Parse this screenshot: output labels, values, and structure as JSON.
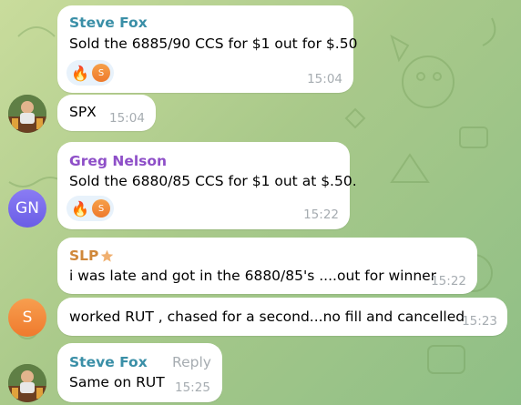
{
  "messages": [
    {
      "sender": "Steve Fox",
      "name_color": "#3a8fa7",
      "text": "Sold the 6885/90 CCS for $1 out for $.50",
      "time": "15:04",
      "reaction": {
        "emoji": "🔥",
        "avatar_letter": "S"
      }
    },
    {
      "text": "SPX",
      "time": "15:04"
    },
    {
      "sender": "Greg Nelson",
      "name_color": "#8e4fc8",
      "text": "Sold the 6880/85 CCS for $1 out at $.50.",
      "time": "15:22",
      "reaction": {
        "emoji": "🔥",
        "avatar_letter": "S"
      },
      "avatar_initials": "GN"
    },
    {
      "sender": "SLP",
      "name_color": "#d0883a",
      "text": "i was late and got in the 6880/85's ....out for winner",
      "time": "15:22"
    },
    {
      "text": "worked RUT , chased for a second...no fill and cancelled",
      "time": "15:23",
      "avatar_initials": "S"
    },
    {
      "sender": "Steve Fox",
      "name_color": "#3a8fa7",
      "reply_label": "Reply",
      "text": "Same on RUT",
      "time": "15:25"
    }
  ],
  "colors": {
    "gn_avatar": "#7b6df0",
    "s_avatar": "#f58a3a",
    "star": "#f0b070"
  }
}
